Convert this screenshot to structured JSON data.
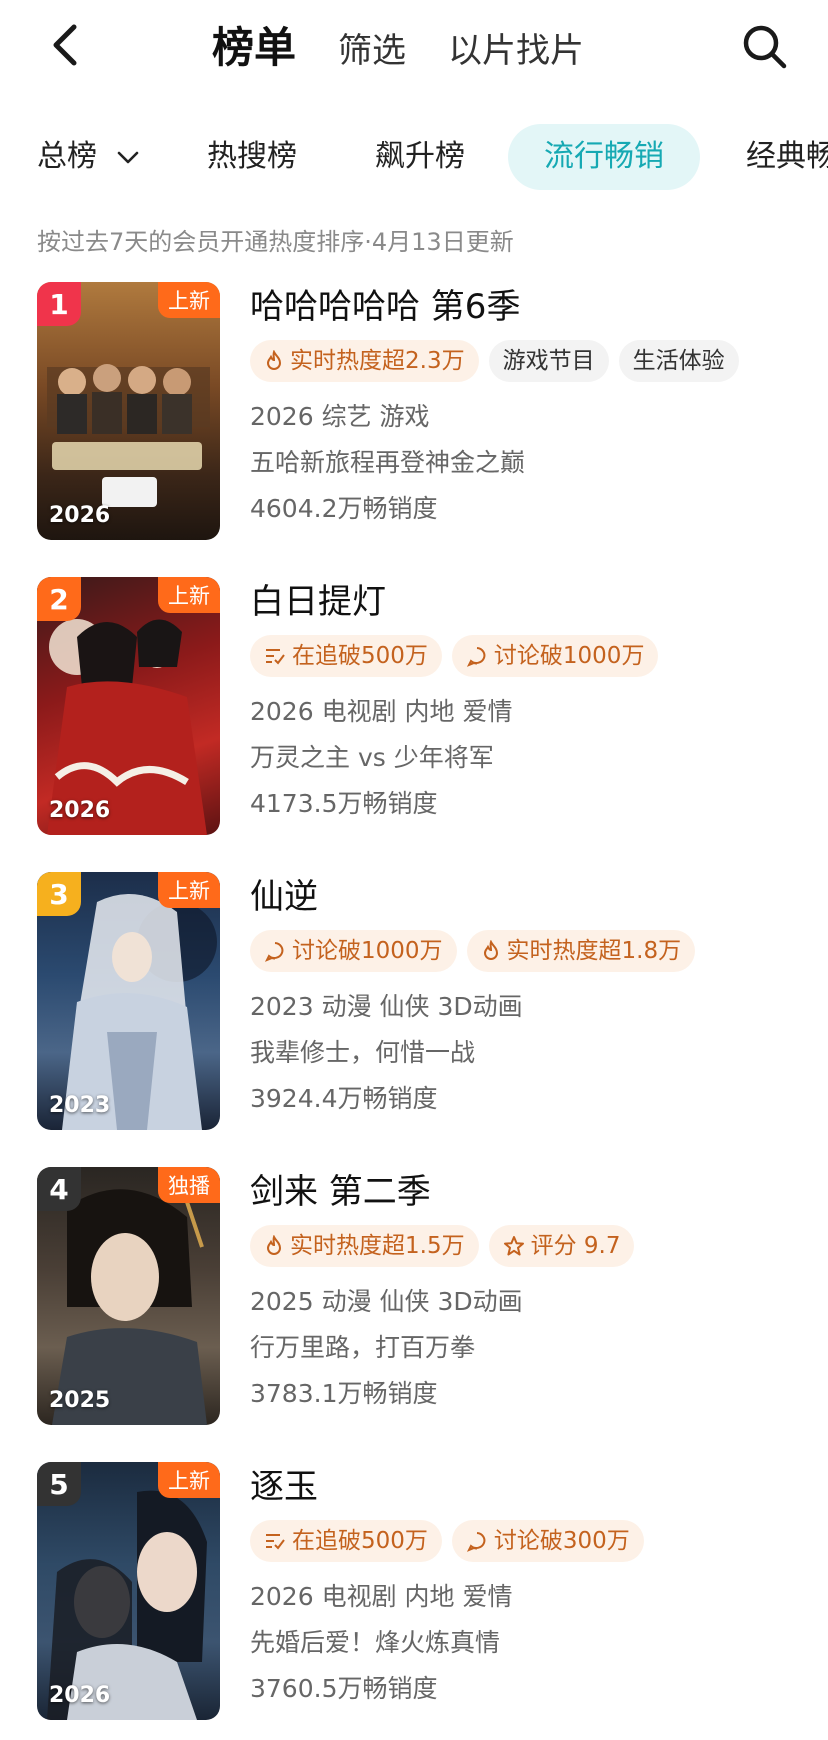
{
  "header": {
    "tabs": [
      "榜单",
      "筛选",
      "以片找片"
    ]
  },
  "categories": {
    "total_label": "总榜",
    "items": [
      "热搜榜",
      "飙升榜",
      "流行畅销",
      "经典畅"
    ]
  },
  "subtitle": "按过去7天的会员开通热度排序·4月13日更新",
  "list": [
    {
      "rank": "1",
      "badge": "上新",
      "year": "2026",
      "title": "哈哈哈哈哈 第6季",
      "tags": [
        {
          "icon": "flame-icon",
          "text": "实时热度超2.3万"
        },
        {
          "text": "游戏节目"
        },
        {
          "text": "生活体验"
        }
      ],
      "meta": "2026 综艺 游戏",
      "desc": "五哈新旅程再登神金之巅",
      "sales": "4604.2万畅销度"
    },
    {
      "rank": "2",
      "badge": "上新",
      "year": "2026",
      "title": "白日提灯",
      "tags": [
        {
          "icon": "follow-list-icon",
          "text": "在追破500万"
        },
        {
          "icon": "chat-bubble-icon",
          "text": "讨论破1000万"
        }
      ],
      "meta": "2026 电视剧 内地 爱情",
      "desc": "万灵之主 vs 少年将军",
      "sales": "4173.5万畅销度"
    },
    {
      "rank": "3",
      "badge": "上新",
      "year": "2023",
      "title": "仙逆",
      "tags": [
        {
          "icon": "chat-bubble-icon",
          "text": "讨论破1000万"
        },
        {
          "icon": "flame-icon",
          "text": "实时热度超1.8万"
        }
      ],
      "meta": "2023 动漫 仙侠 3D动画",
      "desc": "我辈修士，何惜一战",
      "sales": "3924.4万畅销度"
    },
    {
      "rank": "4",
      "badge": "独播",
      "year": "2025",
      "title": "剑来 第二季",
      "tags": [
        {
          "icon": "flame-icon",
          "text": "实时热度超1.5万"
        },
        {
          "icon": "star-icon",
          "text": "评分 9.7"
        }
      ],
      "meta": "2025 动漫 仙侠 3D动画",
      "desc": "行万里路，打百万拳",
      "sales": "3783.1万畅销度"
    },
    {
      "rank": "5",
      "badge": "上新",
      "year": "2026",
      "title": "逐玉",
      "tags": [
        {
          "icon": "follow-list-icon",
          "text": "在追破500万"
        },
        {
          "icon": "chat-bubble-icon",
          "text": "讨论破300万"
        }
      ],
      "meta": "2026 电视剧 内地 爱情",
      "desc": "先婚后爱！烽火炼真情",
      "sales": "3760.5万畅销度"
    }
  ],
  "colors": {
    "accent": "#16a9b3",
    "accent_bg": "#e3f6f7",
    "badge": "#ff6a1a",
    "rank1": "#f0344b",
    "rank2": "#ff6a1a",
    "rank3": "#f6b01e",
    "rank_other": "#333333",
    "tag_hot_bg": "#fdf1e7",
    "tag_hot_text": "#c4621e"
  }
}
